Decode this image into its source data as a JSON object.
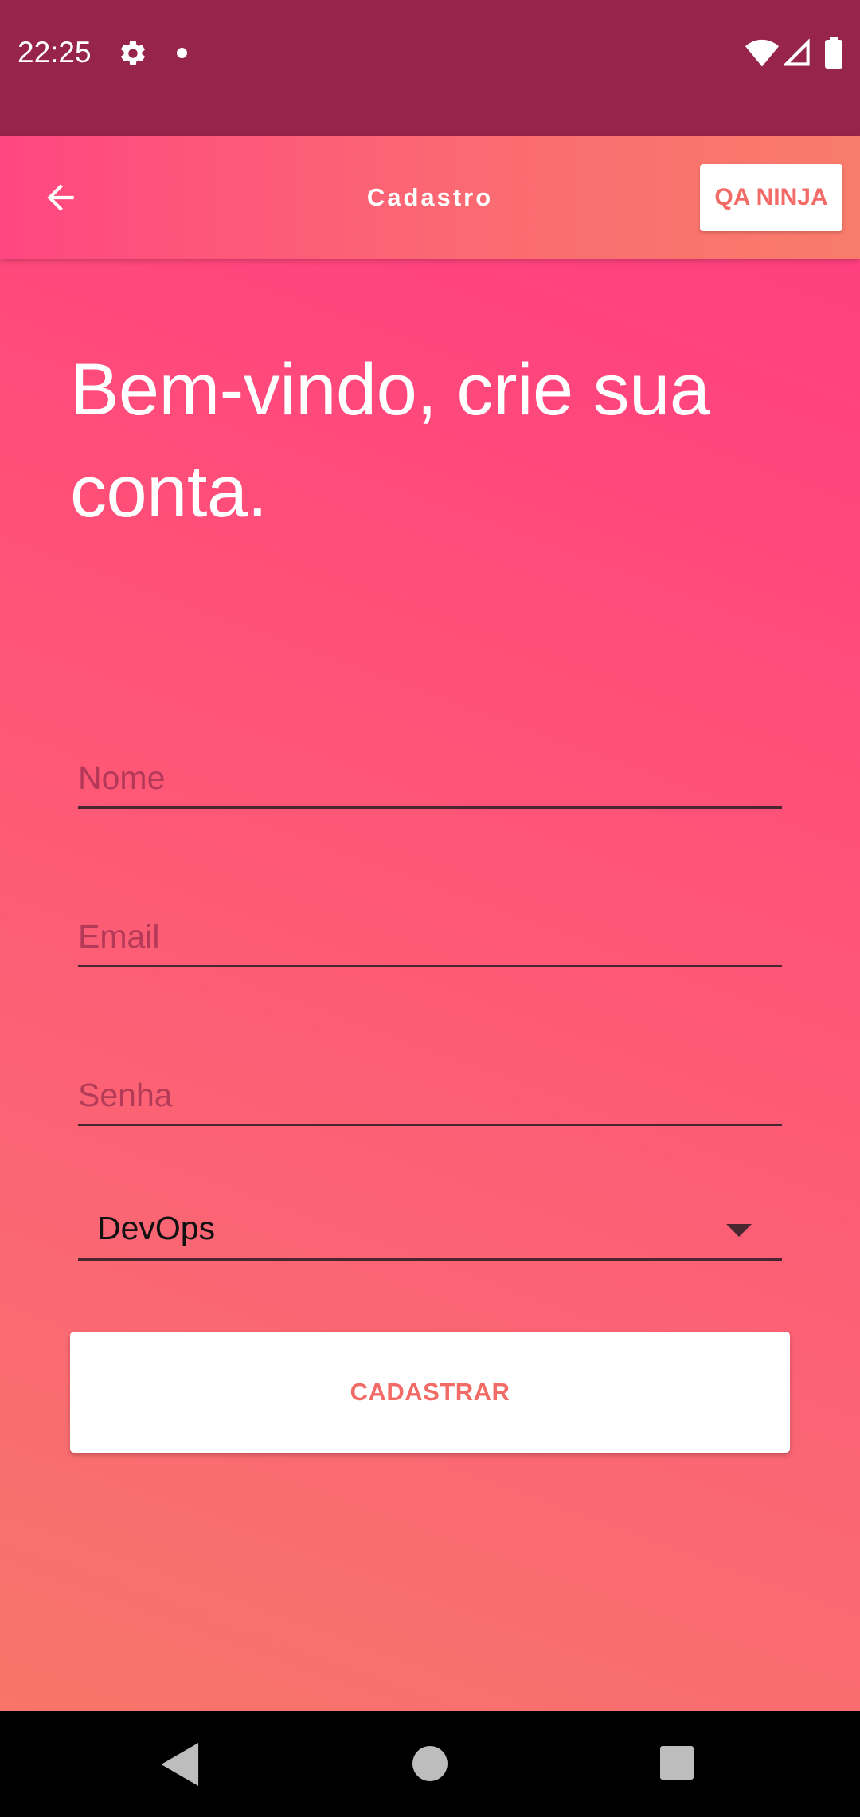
{
  "status_bar": {
    "time": "22:25",
    "icons": [
      "gear-icon",
      "notification-dot-icon",
      "wifi-icon",
      "signal-icon",
      "battery-icon"
    ]
  },
  "app_bar": {
    "title": "Cadastro",
    "back_icon": "arrow-left-icon",
    "action_label": "QA NINJA"
  },
  "form": {
    "headline": "Bem-vindo, crie sua conta.",
    "name_placeholder": "Nome",
    "email_placeholder": "Email",
    "password_placeholder": "Senha",
    "role_selected": "DevOps",
    "submit_label": "CADASTRAR"
  },
  "nav_bar": {
    "icons": [
      "nav-back-icon",
      "nav-home-icon",
      "nav-recents-icon"
    ]
  },
  "colors": {
    "status_bar": "#96244b",
    "accent": "#f36b67",
    "gradient_top": "#ff3f7f",
    "gradient_bottom": "#f8756a"
  }
}
